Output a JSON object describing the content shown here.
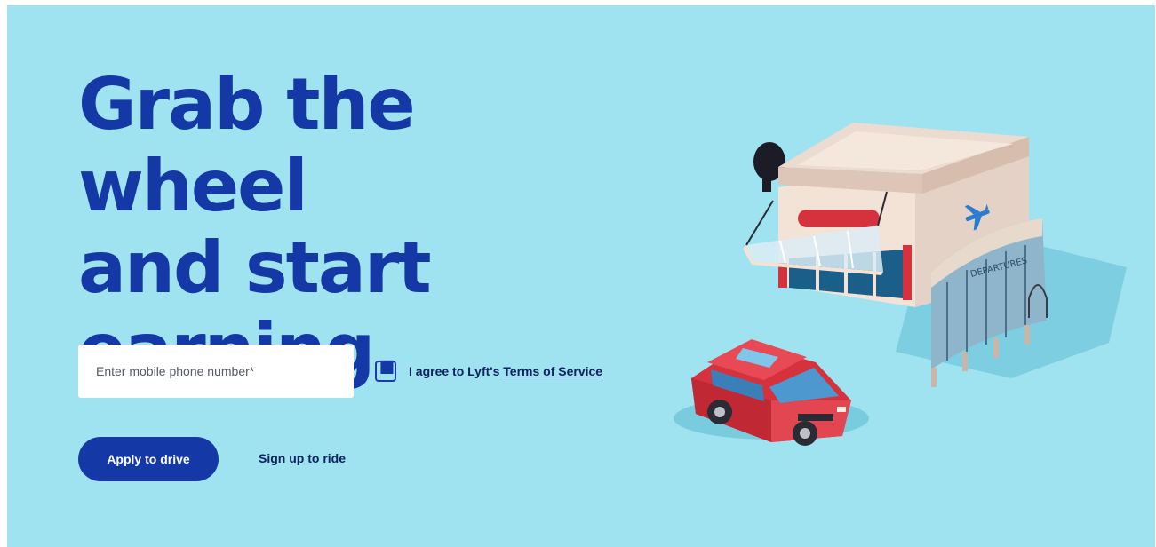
{
  "hero": {
    "headline_line_1": "Grab the wheel",
    "headline_line_2": "and start",
    "headline_line_3": "earning."
  },
  "form": {
    "phone_placeholder": "Enter mobile phone number*",
    "phone_value": "",
    "agree_prefix": "I agree to Lyft's ",
    "terms_link": "Terms of Service",
    "agree_checked": false
  },
  "actions": {
    "apply_label": "Apply to drive",
    "ride_label": "Sign up to ride"
  },
  "illustration": {
    "building_icon": "airport-terminal-icon",
    "car_icon": "red-suv-icon",
    "sign_text": "DEPARTURES"
  },
  "colors": {
    "background": "#9fe3f0",
    "brand_blue": "#1438a6",
    "text_dark": "#0d2260",
    "car_red": "#d6323d",
    "building_cream": "#f2e3d6"
  }
}
